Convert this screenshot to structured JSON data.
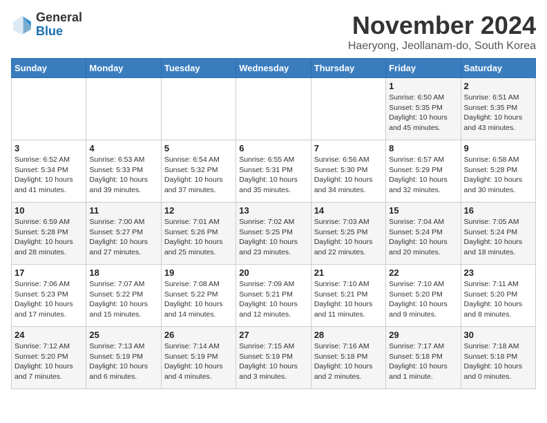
{
  "header": {
    "logo_general": "General",
    "logo_blue": "Blue",
    "month_title": "November 2024",
    "location": "Haeryong, Jeollanam-do, South Korea"
  },
  "days_of_week": [
    "Sunday",
    "Monday",
    "Tuesday",
    "Wednesday",
    "Thursday",
    "Friday",
    "Saturday"
  ],
  "weeks": [
    [
      {
        "day": "",
        "info": ""
      },
      {
        "day": "",
        "info": ""
      },
      {
        "day": "",
        "info": ""
      },
      {
        "day": "",
        "info": ""
      },
      {
        "day": "",
        "info": ""
      },
      {
        "day": "1",
        "info": "Sunrise: 6:50 AM\nSunset: 5:35 PM\nDaylight: 10 hours\nand 45 minutes."
      },
      {
        "day": "2",
        "info": "Sunrise: 6:51 AM\nSunset: 5:35 PM\nDaylight: 10 hours\nand 43 minutes."
      }
    ],
    [
      {
        "day": "3",
        "info": "Sunrise: 6:52 AM\nSunset: 5:34 PM\nDaylight: 10 hours\nand 41 minutes."
      },
      {
        "day": "4",
        "info": "Sunrise: 6:53 AM\nSunset: 5:33 PM\nDaylight: 10 hours\nand 39 minutes."
      },
      {
        "day": "5",
        "info": "Sunrise: 6:54 AM\nSunset: 5:32 PM\nDaylight: 10 hours\nand 37 minutes."
      },
      {
        "day": "6",
        "info": "Sunrise: 6:55 AM\nSunset: 5:31 PM\nDaylight: 10 hours\nand 35 minutes."
      },
      {
        "day": "7",
        "info": "Sunrise: 6:56 AM\nSunset: 5:30 PM\nDaylight: 10 hours\nand 34 minutes."
      },
      {
        "day": "8",
        "info": "Sunrise: 6:57 AM\nSunset: 5:29 PM\nDaylight: 10 hours\nand 32 minutes."
      },
      {
        "day": "9",
        "info": "Sunrise: 6:58 AM\nSunset: 5:28 PM\nDaylight: 10 hours\nand 30 minutes."
      }
    ],
    [
      {
        "day": "10",
        "info": "Sunrise: 6:59 AM\nSunset: 5:28 PM\nDaylight: 10 hours\nand 28 minutes."
      },
      {
        "day": "11",
        "info": "Sunrise: 7:00 AM\nSunset: 5:27 PM\nDaylight: 10 hours\nand 27 minutes."
      },
      {
        "day": "12",
        "info": "Sunrise: 7:01 AM\nSunset: 5:26 PM\nDaylight: 10 hours\nand 25 minutes."
      },
      {
        "day": "13",
        "info": "Sunrise: 7:02 AM\nSunset: 5:25 PM\nDaylight: 10 hours\nand 23 minutes."
      },
      {
        "day": "14",
        "info": "Sunrise: 7:03 AM\nSunset: 5:25 PM\nDaylight: 10 hours\nand 22 minutes."
      },
      {
        "day": "15",
        "info": "Sunrise: 7:04 AM\nSunset: 5:24 PM\nDaylight: 10 hours\nand 20 minutes."
      },
      {
        "day": "16",
        "info": "Sunrise: 7:05 AM\nSunset: 5:24 PM\nDaylight: 10 hours\nand 18 minutes."
      }
    ],
    [
      {
        "day": "17",
        "info": "Sunrise: 7:06 AM\nSunset: 5:23 PM\nDaylight: 10 hours\nand 17 minutes."
      },
      {
        "day": "18",
        "info": "Sunrise: 7:07 AM\nSunset: 5:22 PM\nDaylight: 10 hours\nand 15 minutes."
      },
      {
        "day": "19",
        "info": "Sunrise: 7:08 AM\nSunset: 5:22 PM\nDaylight: 10 hours\nand 14 minutes."
      },
      {
        "day": "20",
        "info": "Sunrise: 7:09 AM\nSunset: 5:21 PM\nDaylight: 10 hours\nand 12 minutes."
      },
      {
        "day": "21",
        "info": "Sunrise: 7:10 AM\nSunset: 5:21 PM\nDaylight: 10 hours\nand 11 minutes."
      },
      {
        "day": "22",
        "info": "Sunrise: 7:10 AM\nSunset: 5:20 PM\nDaylight: 10 hours\nand 9 minutes."
      },
      {
        "day": "23",
        "info": "Sunrise: 7:11 AM\nSunset: 5:20 PM\nDaylight: 10 hours\nand 8 minutes."
      }
    ],
    [
      {
        "day": "24",
        "info": "Sunrise: 7:12 AM\nSunset: 5:20 PM\nDaylight: 10 hours\nand 7 minutes."
      },
      {
        "day": "25",
        "info": "Sunrise: 7:13 AM\nSunset: 5:19 PM\nDaylight: 10 hours\nand 6 minutes."
      },
      {
        "day": "26",
        "info": "Sunrise: 7:14 AM\nSunset: 5:19 PM\nDaylight: 10 hours\nand 4 minutes."
      },
      {
        "day": "27",
        "info": "Sunrise: 7:15 AM\nSunset: 5:19 PM\nDaylight: 10 hours\nand 3 minutes."
      },
      {
        "day": "28",
        "info": "Sunrise: 7:16 AM\nSunset: 5:18 PM\nDaylight: 10 hours\nand 2 minutes."
      },
      {
        "day": "29",
        "info": "Sunrise: 7:17 AM\nSunset: 5:18 PM\nDaylight: 10 hours\nand 1 minute."
      },
      {
        "day": "30",
        "info": "Sunrise: 7:18 AM\nSunset: 5:18 PM\nDaylight: 10 hours\nand 0 minutes."
      }
    ]
  ]
}
